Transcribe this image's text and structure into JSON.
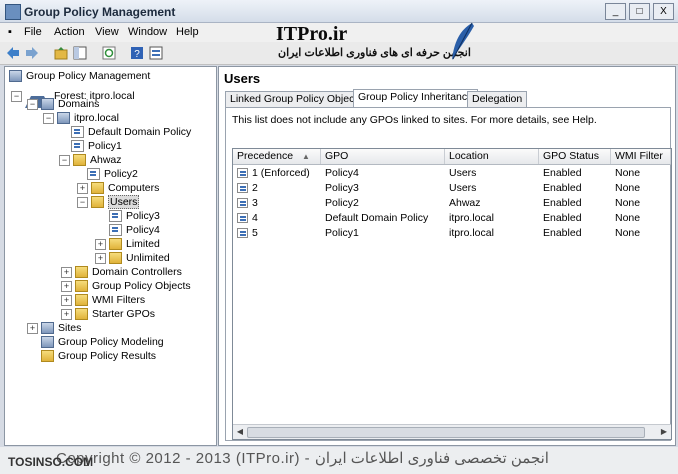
{
  "window": {
    "title": "Group Policy Management",
    "buttons": [
      "_",
      "□",
      "X"
    ]
  },
  "menu": [
    "File",
    "Action",
    "View",
    "Window",
    "Help"
  ],
  "branding": {
    "name": "ITPro.ir",
    "tagline": "انجمن حرفه ای های فناوری اطلاعات ایران"
  },
  "tree": {
    "root": "Group Policy Management",
    "forest": "Forest: itpro.local",
    "domains": "Domains",
    "domain": "itpro.local",
    "default_policy": "Default Domain Policy",
    "policy1": "Policy1",
    "ahwaz": "Ahwaz",
    "policy2": "Policy2",
    "computers": "Computers",
    "users": "Users",
    "policy3": "Policy3",
    "policy4": "Policy4",
    "limited": "Limited",
    "unlimited": "Unlimited",
    "domain_controllers": "Domain Controllers",
    "gpo_objects": "Group Policy Objects",
    "wmi_filters": "WMI Filters",
    "starter_gpos": "Starter GPOs",
    "sites": "Sites",
    "modeling": "Group Policy Modeling",
    "results": "Group Policy Results"
  },
  "main": {
    "title": "Users",
    "tabs": [
      "Linked Group Policy Objects",
      "Group Policy Inheritance",
      "Delegation"
    ],
    "active_tab": "Group Policy Inheritance",
    "note": "This list does not include any GPOs linked to sites. For more details, see Help.",
    "columns": [
      "Precedence",
      "GPO",
      "Location",
      "GPO Status",
      "WMI Filter"
    ],
    "rows": [
      [
        "1  (Enforced)",
        "Policy4",
        "Users",
        "Enabled",
        "None"
      ],
      [
        "2",
        "Policy3",
        "Users",
        "Enabled",
        "None"
      ],
      [
        "3",
        "Policy2",
        "Ahwaz",
        "Enabled",
        "None"
      ],
      [
        "4",
        "Default Domain Policy",
        "itpro.local",
        "Enabled",
        "None"
      ],
      [
        "5",
        "Policy1",
        "itpro.local",
        "Enabled",
        "None"
      ]
    ]
  },
  "footer": {
    "watermark": "Copyright © 2012 - 2013 (ITPro.ir) - انجمن تخصصی فناوری اطلاعات ایران",
    "site": "TOSINSO.COM"
  }
}
